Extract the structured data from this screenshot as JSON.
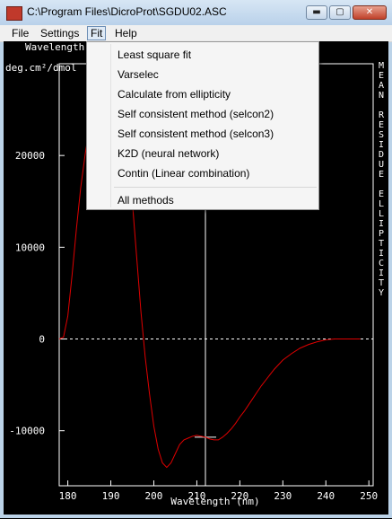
{
  "window": {
    "title": "C:\\Program Files\\DicroProt\\SGDU02.ASC",
    "buttons": {
      "minimize": "▬",
      "maximize": "▢",
      "close": "✕"
    }
  },
  "menubar": {
    "items": [
      "File",
      "Settings",
      "Fit",
      "Help"
    ],
    "active": "Fit"
  },
  "fit_menu": {
    "items": [
      "Least square fit",
      "Varselec",
      "Calculate from ellipticity",
      "Self consistent method (selcon2)",
      "Self consistent method (selcon3)",
      "K2D (neural network)",
      "Contin (Linear combination)"
    ],
    "all_methods": "All methods"
  },
  "plot": {
    "top_label": "Wavelength",
    "y_unit_label": "deg.cm²/dmol",
    "right_title": "MEAN RESIDUE ELLIPTICITY",
    "x_axis_title": "Wavelength (nm)",
    "background": "#000000",
    "curve_color": "#e00000",
    "axis_color": "#ffffff"
  },
  "chart_data": {
    "type": "line",
    "xlabel": "Wavelength (nm)",
    "ylabel": "deg.cm²/dmol",
    "title": "MEAN RESIDUE ELLIPTICITY",
    "x_ticks": [
      "180",
      "190",
      "200",
      "210",
      "220",
      "230",
      "240",
      "250"
    ],
    "y_ticks": [
      "20000",
      "10000",
      "0",
      "-10000"
    ],
    "xlim": [
      178,
      251
    ],
    "ylim": [
      -16000,
      30000
    ],
    "cursor_x": 212,
    "series": [
      {
        "x": [
          178,
          179,
          180,
          181,
          182,
          183,
          184,
          185,
          186,
          187,
          188,
          189,
          190,
          191,
          192,
          193,
          194,
          195,
          196,
          197,
          198,
          199,
          200,
          201,
          202,
          203,
          204,
          205,
          206,
          207,
          208,
          209,
          210,
          211,
          212,
          213,
          214,
          215,
          216,
          217,
          218,
          219,
          220,
          221,
          222,
          223,
          224,
          225,
          226,
          227,
          228,
          229,
          230,
          232,
          234,
          236,
          238,
          240,
          242,
          244,
          246,
          248
        ],
        "y": [
          0,
          200,
          2500,
          7000,
          12000,
          16500,
          20000,
          23000,
          25500,
          27000,
          28000,
          28500,
          28500,
          28000,
          26500,
          24000,
          20000,
          15000,
          9000,
          3000,
          -2000,
          -6000,
          -9500,
          -12000,
          -13500,
          -14000,
          -13500,
          -12500,
          -11500,
          -11000,
          -10800,
          -10600,
          -10500,
          -10600,
          -10700,
          -10900,
          -11000,
          -11000,
          -10700,
          -10300,
          -9800,
          -9200,
          -8500,
          -7900,
          -7200,
          -6500,
          -5800,
          -5100,
          -4500,
          -3900,
          -3300,
          -2800,
          -2300,
          -1600,
          -1000,
          -600,
          -300,
          -100,
          0,
          0,
          0,
          0
        ]
      }
    ]
  }
}
